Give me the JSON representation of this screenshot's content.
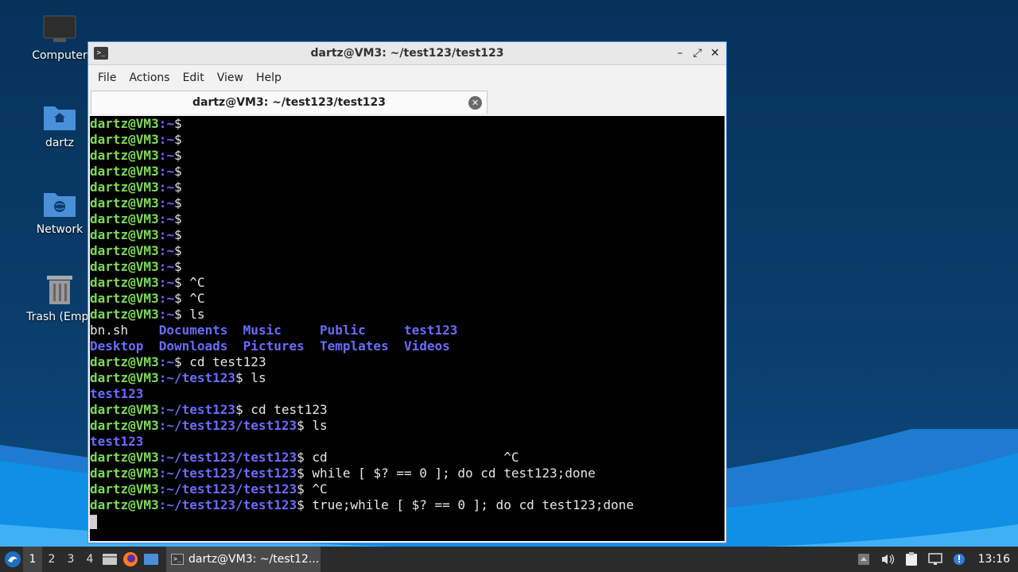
{
  "desktop": {
    "icons": [
      {
        "label": "Computer",
        "icon": "computer-icon"
      },
      {
        "label": "dartz",
        "icon": "home-folder-icon"
      },
      {
        "label": "Network",
        "icon": "network-folder-icon"
      },
      {
        "label": "Trash (Empt",
        "icon": "trash-icon"
      }
    ]
  },
  "window": {
    "title": "dartz@VM3: ~/test123/test123",
    "menu": [
      "File",
      "Actions",
      "Edit",
      "View",
      "Help"
    ],
    "tab_label": "dartz@VM3: ~/test123/test123",
    "controls": {
      "minimize": "–",
      "maximize": "⤢",
      "close": "✕"
    }
  },
  "terminal": {
    "user": "dartz@VM3",
    "lines": [
      {
        "path": ":~",
        "cmd": ""
      },
      {
        "path": ":~",
        "cmd": ""
      },
      {
        "path": ":~",
        "cmd": ""
      },
      {
        "path": ":~",
        "cmd": ""
      },
      {
        "path": ":~",
        "cmd": ""
      },
      {
        "path": ":~",
        "cmd": ""
      },
      {
        "path": ":~",
        "cmd": ""
      },
      {
        "path": ":~",
        "cmd": ""
      },
      {
        "path": ":~",
        "cmd": ""
      },
      {
        "path": ":~",
        "cmd": ""
      },
      {
        "path": ":~",
        "cmd": " ^C"
      },
      {
        "path": ":~",
        "cmd": " ^C"
      },
      {
        "path": ":~",
        "cmd": " ls"
      }
    ],
    "ls_home": [
      [
        {
          "t": "bn.sh    ",
          "dir": false
        },
        {
          "t": "Documents",
          "dir": true
        },
        {
          "t": "  ",
          "dir": false
        },
        {
          "t": "Music",
          "dir": true
        },
        {
          "t": "     ",
          "dir": false
        },
        {
          "t": "Public",
          "dir": true
        },
        {
          "t": "     ",
          "dir": false
        },
        {
          "t": "test123",
          "dir": true
        }
      ],
      [
        {
          "t": "Desktop",
          "dir": true
        },
        {
          "t": "  ",
          "dir": false
        },
        {
          "t": "Downloads",
          "dir": true
        },
        {
          "t": "  ",
          "dir": false
        },
        {
          "t": "Pictures",
          "dir": true
        },
        {
          "t": "  ",
          "dir": false
        },
        {
          "t": "Templates",
          "dir": true
        },
        {
          "t": "  ",
          "dir": false
        },
        {
          "t": "Videos",
          "dir": true
        }
      ]
    ],
    "lines2": [
      {
        "path": ":~",
        "cmd": " cd test123",
        "out": null
      },
      {
        "path": ":~/test123",
        "cmd": " ls",
        "out": "test123"
      },
      {
        "path": ":~/test123",
        "cmd": " cd test123",
        "out": null
      },
      {
        "path": ":~/test123/test123",
        "cmd": " ls",
        "out": "test123"
      },
      {
        "path": ":~/test123/test123",
        "cmd": " cd                       ^C",
        "out": null
      },
      {
        "path": ":~/test123/test123",
        "cmd": " while [ $? == 0 ]; do cd test123;done",
        "out": null
      },
      {
        "path": ":~/test123/test123",
        "cmd": " ^C",
        "out": null
      },
      {
        "path": ":~/test123/test123",
        "cmd": " true;while [ $? == 0 ]; do cd test123;done",
        "out": null
      }
    ],
    "prompt_symbol": "$"
  },
  "taskbar": {
    "workspaces": [
      "1",
      "2",
      "3",
      "4"
    ],
    "active_workspace": "1",
    "task_label": "dartz@VM3: ~/test12...",
    "clock": "13:16"
  },
  "colors": {
    "prompt_user": "#7cdc55",
    "prompt_path": "#6b6bff",
    "window_border": "#4d8fd0"
  }
}
